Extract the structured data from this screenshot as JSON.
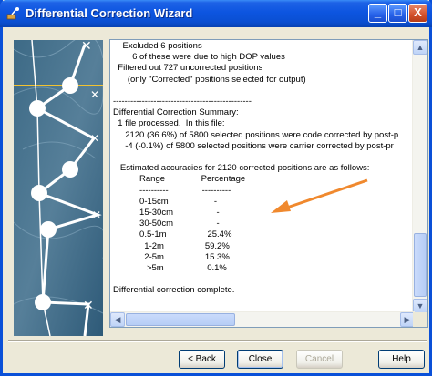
{
  "window": {
    "title": "Differential Correction Wizard",
    "title_icon": "satellite-icon",
    "controls": {
      "minimize": "_",
      "maximize": "□",
      "close": "X"
    }
  },
  "log": {
    "lines": [
      "    Excluded 6 positions",
      "        6 of these were due to high DOP values",
      "  Filtered out 727 uncorrected positions",
      "      (only \"Corrected\" positions selected for output)",
      "",
      "------------------------------------------------",
      "Differential Correction Summary:",
      "  1 file processed.  In this file:",
      "     2120 (36.6%) of 5800 selected positions were code corrected by post-p",
      "     -4 (-0.1%) of 5800 selected positions were carrier corrected by post-pr",
      "",
      "   Estimated accuracies for 2120 corrected positions are as follows:",
      "           Range               Percentage",
      "           ----------              ----------",
      "           0-15cm                   -",
      "           15-30cm                  -",
      "           30-50cm                  -",
      "           0.5-1m                 25.4%",
      "             1-2m                 59.2%",
      "             2-5m                 15.3%",
      "              >5m                  0.1%",
      "",
      "Differential correction complete."
    ]
  },
  "scrollbar": {
    "up": "▲",
    "down": "▼",
    "left": "◀",
    "right": "▶"
  },
  "buttons": {
    "back": "< Back",
    "close": "Close",
    "cancel": "Cancel",
    "help": "Help"
  },
  "colors": {
    "titlebar": "#0a4fd2",
    "window_bg": "#ece9d8",
    "annotation_arrow": "#f0892e"
  }
}
